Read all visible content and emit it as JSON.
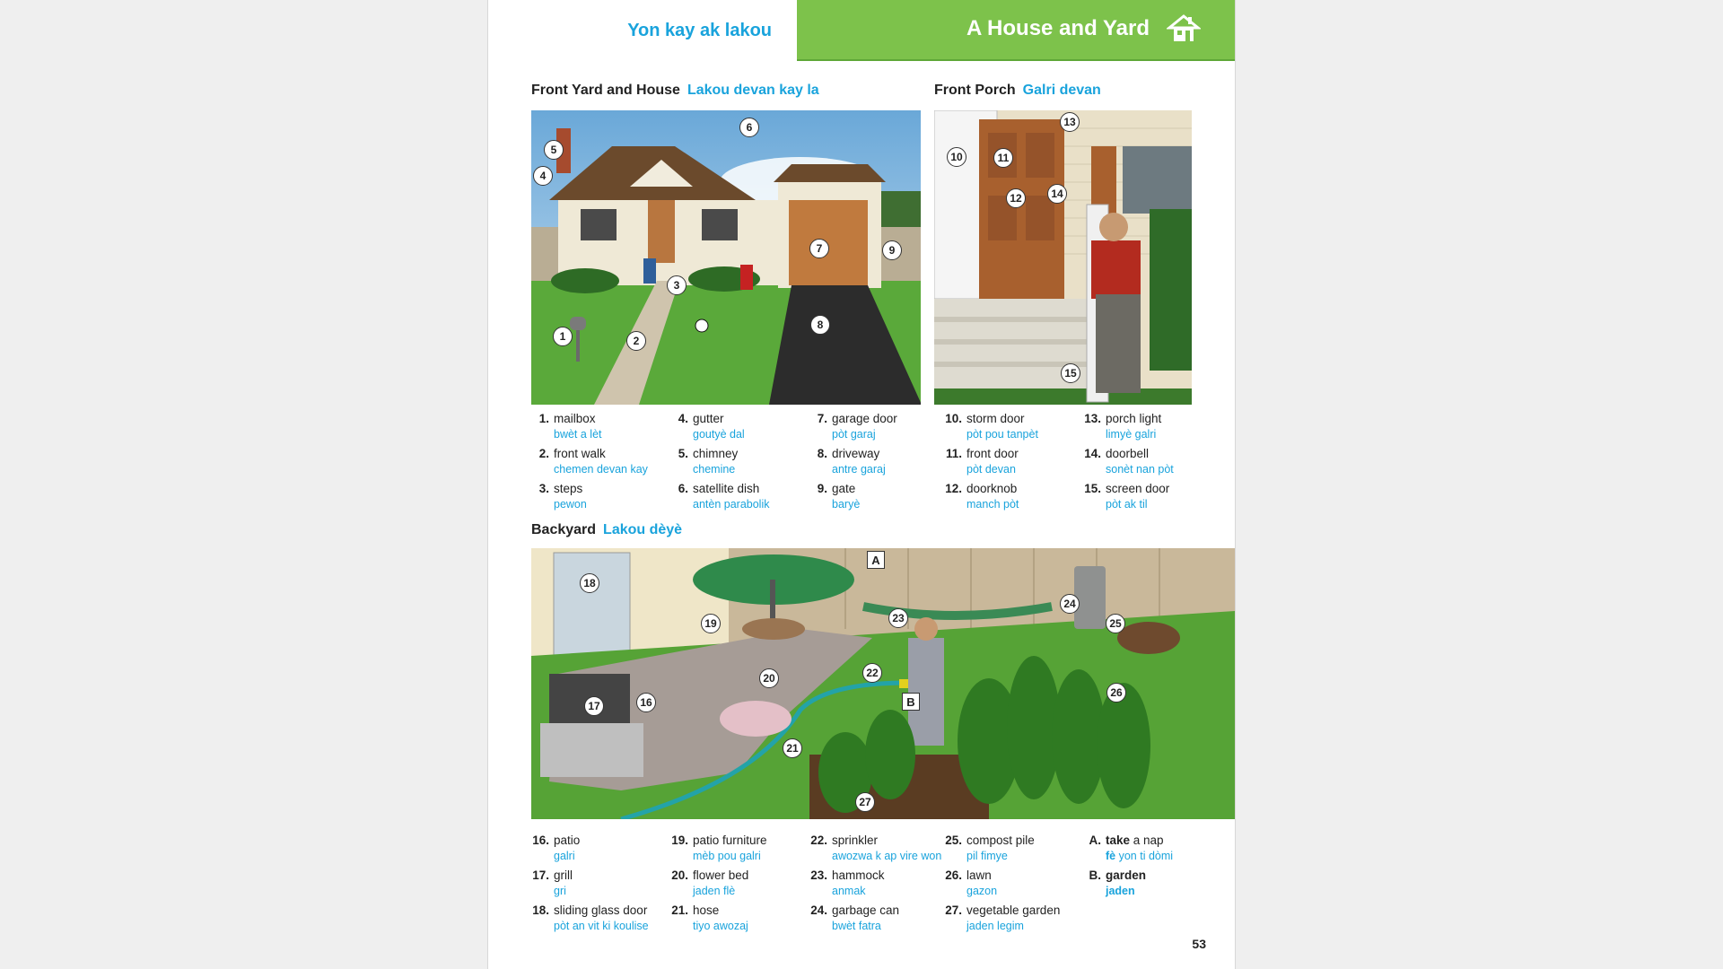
{
  "header": {
    "left_title": "Yon kay ak lakou",
    "right_title": "A House and Yard",
    "accent": "#7dc24b",
    "blue": "#19a3dc"
  },
  "sections": {
    "front_yard": {
      "title": "Front Yard and House",
      "kreyol": "Lakou devan kay la"
    },
    "front_porch": {
      "title": "Front Porch",
      "kreyol": "Galri devan"
    },
    "backyard": {
      "title": "Backyard",
      "kreyol": "Lakou dèyè"
    }
  },
  "callouts": {
    "front_yard": [
      "1",
      "2",
      "3",
      "4",
      "5",
      "6",
      "7",
      "8",
      "9"
    ],
    "front_porch": [
      "10",
      "11",
      "12",
      "13",
      "14",
      "15"
    ],
    "backyard": [
      "16",
      "17",
      "18",
      "19",
      "20",
      "21",
      "22",
      "23",
      "24",
      "25",
      "26",
      "27"
    ],
    "backyard_letters": [
      "A",
      "B"
    ]
  },
  "vocab": {
    "col1": [
      {
        "n": "1.",
        "en": "mailbox",
        "ht": "bwèt a lèt"
      },
      {
        "n": "2.",
        "en": "front walk",
        "ht": "chemen devan kay"
      },
      {
        "n": "3.",
        "en": "steps",
        "ht": "pewon"
      }
    ],
    "col2": [
      {
        "n": "4.",
        "en": "gutter",
        "ht": "goutyè dal"
      },
      {
        "n": "5.",
        "en": "chimney",
        "ht": "chemine"
      },
      {
        "n": "6.",
        "en": "satellite dish",
        "ht": "antèn parabolik"
      }
    ],
    "col3": [
      {
        "n": "7.",
        "en": "garage door",
        "ht": "pòt garaj"
      },
      {
        "n": "8.",
        "en": "driveway",
        "ht": "antre garaj"
      },
      {
        "n": "9.",
        "en": "gate",
        "ht": "baryè"
      }
    ],
    "col4": [
      {
        "n": "10.",
        "en": "storm door",
        "ht": "pòt pou tanpèt"
      },
      {
        "n": "11.",
        "en": "front door",
        "ht": "pòt devan"
      },
      {
        "n": "12.",
        "en": "doorknob",
        "ht": "manch pòt"
      }
    ],
    "col5": [
      {
        "n": "13.",
        "en": "porch light",
        "ht": "limyè galri"
      },
      {
        "n": "14.",
        "en": "doorbell",
        "ht": "sonèt nan pòt"
      },
      {
        "n": "15.",
        "en": "screen door",
        "ht": "pòt ak til"
      }
    ],
    "back1": [
      {
        "n": "16.",
        "en": "patio",
        "ht": "galri"
      },
      {
        "n": "17.",
        "en": "grill",
        "ht": "gri"
      },
      {
        "n": "18.",
        "en": "sliding glass door",
        "ht": "pòt an vit ki koulise"
      }
    ],
    "back2": [
      {
        "n": "19.",
        "en": "patio furniture",
        "ht": "mèb pou galri"
      },
      {
        "n": "20.",
        "en": "flower bed",
        "ht": "jaden flè"
      },
      {
        "n": "21.",
        "en": "hose",
        "ht": "tiyo awozaj"
      }
    ],
    "back3": [
      {
        "n": "22.",
        "en": "sprinkler",
        "ht": "awozwa k ap vire won"
      },
      {
        "n": "23.",
        "en": "hammock",
        "ht": "anmak"
      },
      {
        "n": "24.",
        "en": "garbage can",
        "ht": "bwèt fatra"
      }
    ],
    "back4": [
      {
        "n": "25.",
        "en": "compost pile",
        "ht": "pil fimye"
      },
      {
        "n": "26.",
        "en": "lawn",
        "ht": "gazon"
      },
      {
        "n": "27.",
        "en": "vegetable garden",
        "ht": "jaden legim"
      }
    ],
    "back5": [
      {
        "n": "A.",
        "en_bold": "take",
        "en_rest": " a nap",
        "ht_bold": "fè",
        "ht_rest": " yon ti dòmi"
      },
      {
        "n": "B.",
        "en_bold": "garden",
        "en_rest": "",
        "ht_bold": "jaden",
        "ht_rest": ""
      }
    ]
  },
  "page_number": "53"
}
